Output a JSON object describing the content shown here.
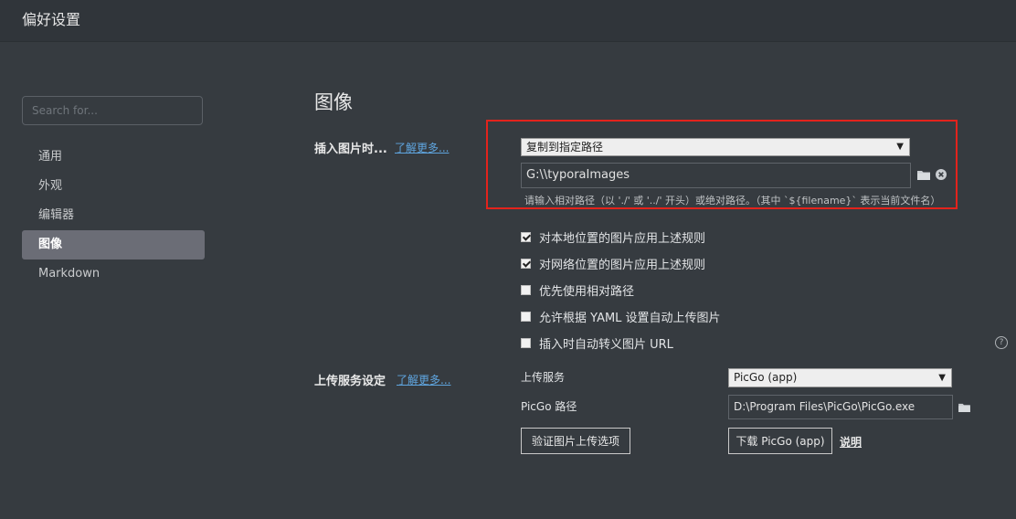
{
  "window": {
    "title": "偏好设置"
  },
  "sidebar": {
    "search_placeholder": "Search for...",
    "items": [
      {
        "label": "通用"
      },
      {
        "label": "外观"
      },
      {
        "label": "编辑器"
      },
      {
        "label": "图像",
        "active": true
      },
      {
        "label": "Markdown"
      }
    ]
  },
  "main": {
    "heading": "图像",
    "insert_image": {
      "label": "插入图片时...",
      "learn_more": "了解更多...",
      "action_select": "复制到指定路径",
      "path_value": "G:\\\\typoraImages",
      "hint": "请输入相对路径（以 './' 或 '../' 开头）或绝对路径。（其中 `${filename}` 表示当前文件名）",
      "folder_icon": "folder-icon",
      "clear_icon": "clear-circle-icon"
    },
    "checkboxes": [
      {
        "label": "对本地位置的图片应用上述规则",
        "checked": true
      },
      {
        "label": "对网络位置的图片应用上述规则",
        "checked": true
      },
      {
        "label": "优先使用相对路径",
        "checked": false
      },
      {
        "label": "允许根据 YAML 设置自动上传图片",
        "checked": false
      },
      {
        "label": "插入时自动转义图片 URL",
        "checked": false
      }
    ],
    "upload": {
      "label": "上传服务设定",
      "learn_more": "了解更多...",
      "service_label": "上传服务",
      "service_value": "PicGo (app)",
      "path_label": "PicGo 路径",
      "path_value": "D:\\Program Files\\PicGo\\PicGo.exe",
      "verify_button": "验证图片上传选项",
      "download_button": "下载 PicGo (app)",
      "explain_link": "说明"
    },
    "help_icon_text": "?"
  }
}
